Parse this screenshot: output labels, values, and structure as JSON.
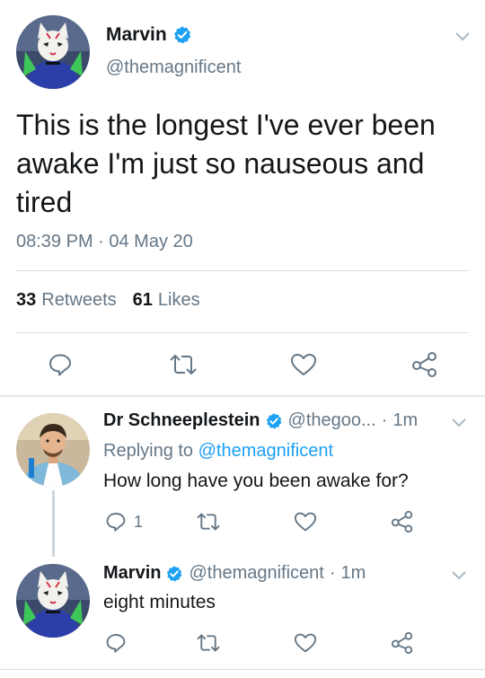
{
  "main_tweet": {
    "author_name": "Marvin",
    "author_handle": "@themagnificent",
    "text": "This is the longest I've ever been awake I'm just so nauseous and tired",
    "timestamp": "08:39 PM · 04 May 20",
    "retweets_count": "33",
    "retweets_label": "Retweets",
    "likes_count": "61",
    "likes_label": "Likes"
  },
  "replies": [
    {
      "author_name": "Dr Schneeplestein",
      "author_handle": "@thegoo...",
      "separator": "·",
      "time": "1m",
      "replying_prefix": "Replying to",
      "replying_to": "@themagnificent",
      "text": "How long have you been awake for?",
      "reply_count": "1"
    },
    {
      "author_name": "Marvin",
      "author_handle": "@themagnificent",
      "separator": "·",
      "time": "1m",
      "text": "eight minutes"
    }
  ],
  "colors": {
    "verified": "#1da1f2",
    "link": "#1da1f2",
    "secondary_text": "#657786",
    "divider": "#d8dde2"
  },
  "icons": [
    "verified-badge-icon",
    "chevron-down-icon",
    "reply-icon",
    "retweet-icon",
    "like-icon",
    "share-icon"
  ]
}
